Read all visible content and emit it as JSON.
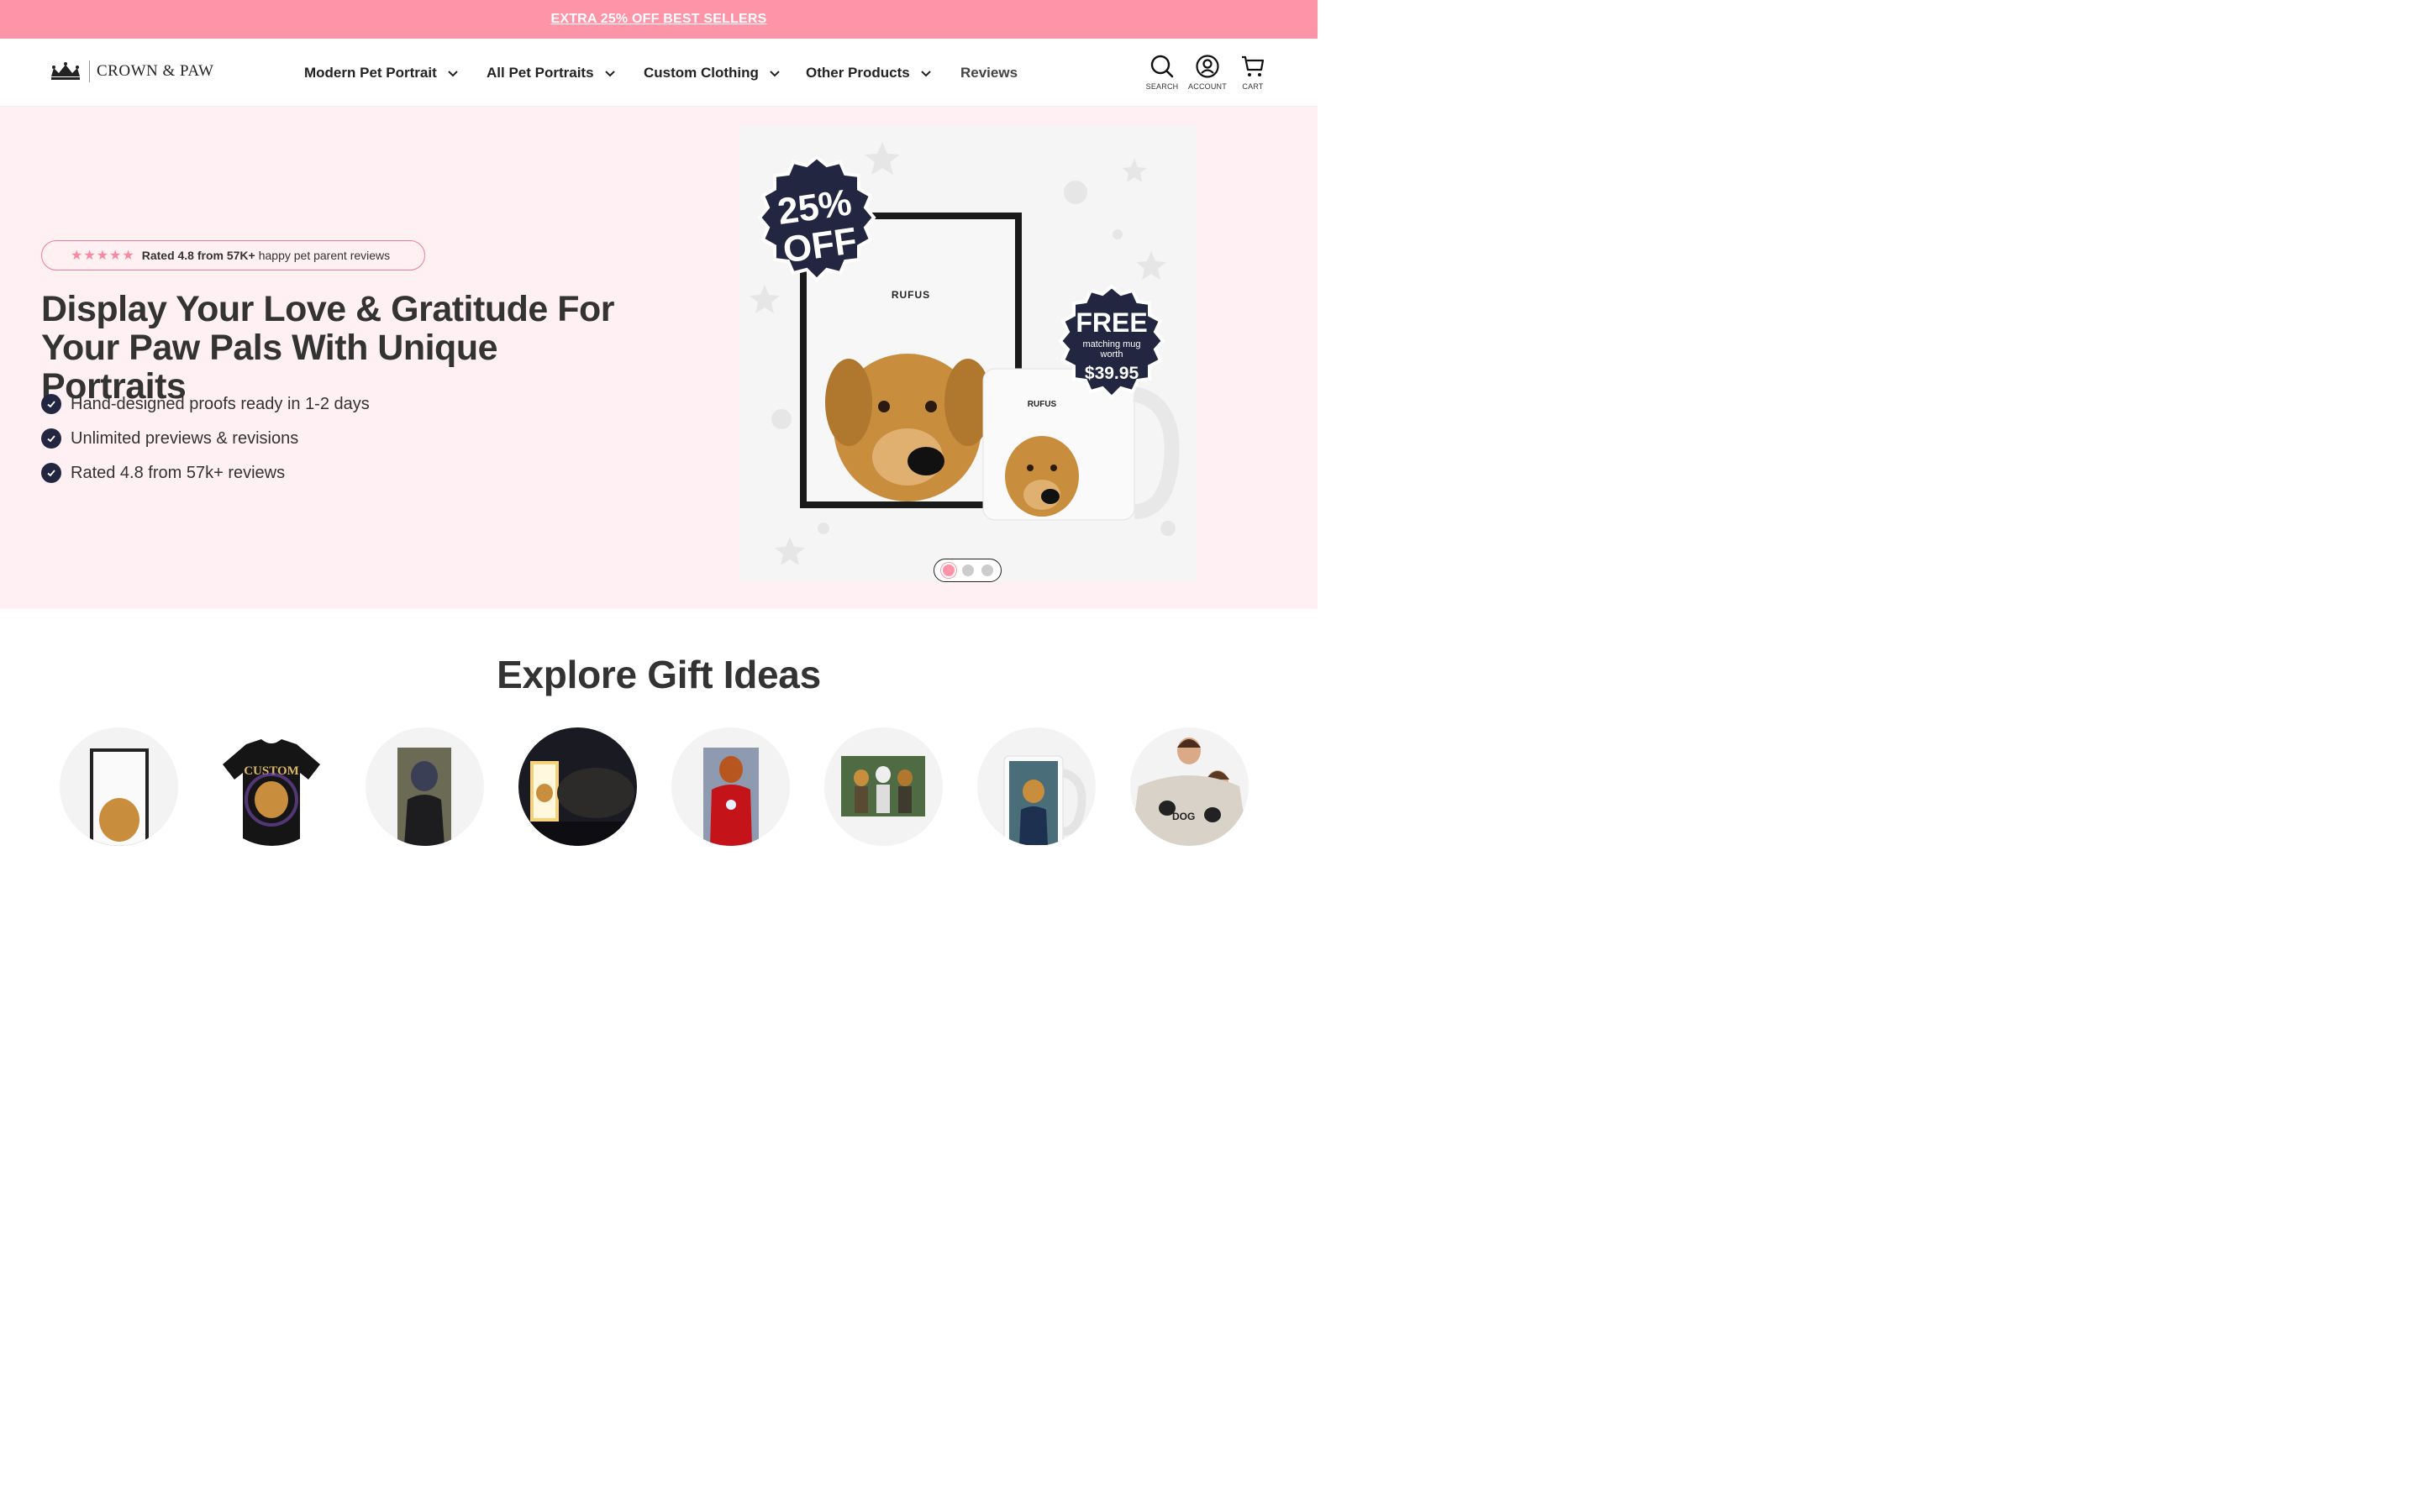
{
  "announcement": {
    "text": "EXTRA 25% OFF BEST SELLERS"
  },
  "header": {
    "brand": "CROWN & PAW",
    "nav": [
      {
        "label": "Modern Pet Portrait",
        "has_dropdown": true
      },
      {
        "label": "All Pet Portraits",
        "has_dropdown": true
      },
      {
        "label": "Custom Clothing",
        "has_dropdown": true
      },
      {
        "label": "Other Products",
        "has_dropdown": true
      },
      {
        "label": "Reviews",
        "has_dropdown": false
      }
    ],
    "icons": [
      {
        "label": "SEARCH",
        "icon": "search-icon"
      },
      {
        "label": "ACCOUNT",
        "icon": "account-icon"
      },
      {
        "label": "CART",
        "icon": "cart-icon"
      }
    ]
  },
  "hero": {
    "rating_stars": "★★★★★",
    "rating_bold": "Rated 4.8 from 57K+",
    "rating_rest": "happy pet parent reviews",
    "headline_line1": "Display Your Love & Gratitude For",
    "headline_line2": "Your Paw Pals With Unique Portraits",
    "bullets": [
      "Hand-designed proofs ready in 1-2 days",
      "Unlimited previews & revisions",
      "Rated 4.8 from 57k+ reviews"
    ],
    "image": {
      "badge_left_line1": "25%",
      "badge_left_line2": "OFF",
      "frame_name": "RUFUS",
      "mug_name": "RUFUS",
      "badge_right_title": "FREE",
      "badge_right_sub1": "matching mug",
      "badge_right_sub2": "worth",
      "badge_right_price": "$39.95"
    },
    "carousel_slides": 3,
    "carousel_active": 1
  },
  "explore": {
    "title": "Explore Gift Ideas",
    "items": [
      {
        "name": "framed-portrait",
        "tshirt_text": ""
      },
      {
        "name": "custom-tshirt",
        "tshirt_text": "CUSTOM"
      },
      {
        "name": "canvas-portrait",
        "tshirt_text": ""
      },
      {
        "name": "night-light",
        "tshirt_text": ""
      },
      {
        "name": "superhero-portrait",
        "tshirt_text": ""
      },
      {
        "name": "group-portrait",
        "tshirt_text": ""
      },
      {
        "name": "mug",
        "tshirt_text": ""
      },
      {
        "name": "custom-sweatshirt",
        "tshirt_text": "DOG"
      }
    ]
  },
  "colors": {
    "announce_bg": "#fd94a8",
    "hero_bg": "#fff0f3",
    "badge_navy": "#232640",
    "accent_pink": "#f58aa0"
  }
}
